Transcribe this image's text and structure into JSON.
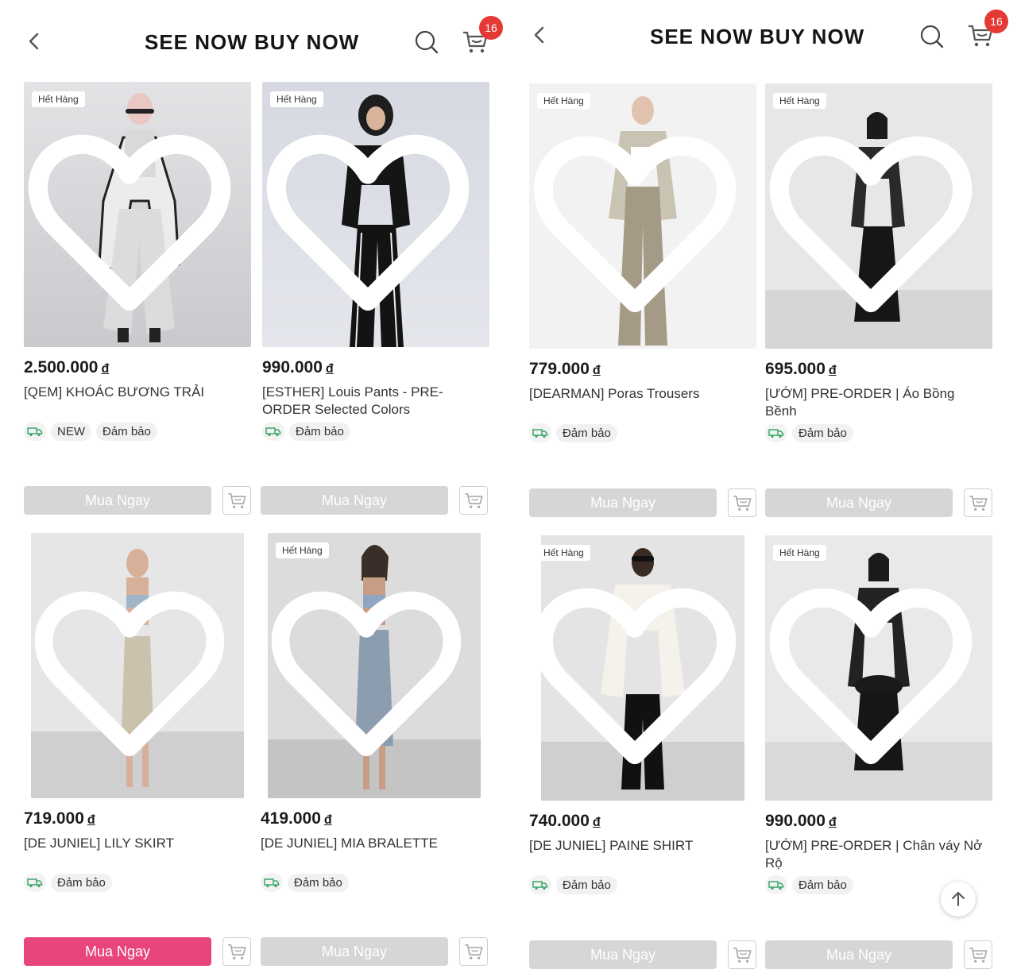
{
  "header": {
    "title": "SEE NOW BUY NOW",
    "cart_count": "16"
  },
  "labels": {
    "out_of_stock": "Hết Hàng",
    "buy_now": "Mua Ngay",
    "guarantee": "Đảm bảo",
    "new": "NEW",
    "currency": "đ"
  },
  "left_screen": {
    "products": [
      {
        "price": "2.500.000",
        "name": "[QEM] KHOÁC BƯƠNG TRẢI"
      },
      {
        "price": "990.000",
        "name": "[ESTHER] Louis Pants - PRE-ORDER Selected Colors"
      },
      {
        "price": "719.000",
        "name": "[DE JUNIEL] LILY SKIRT"
      },
      {
        "price": "419.000",
        "name": "[DE JUNIEL] MIA BRALETTE"
      }
    ]
  },
  "right_screen": {
    "products": [
      {
        "price": "779.000",
        "name": "[DEARMAN] Poras Trousers"
      },
      {
        "price": "695.000",
        "name": "[ƯỚM] PRE-ORDER | Áo Bồng Bềnh"
      },
      {
        "price": "740.000",
        "name": "[DE JUNIEL] PAINE SHIRT"
      },
      {
        "price": "990.000",
        "name": "[ƯỚM] PRE-ORDER | Chân váy Nở Rộ"
      }
    ]
  },
  "colors": {
    "accent": "#e8457c",
    "badge": "#e53935",
    "disabled_button": "#d6d6d6"
  }
}
